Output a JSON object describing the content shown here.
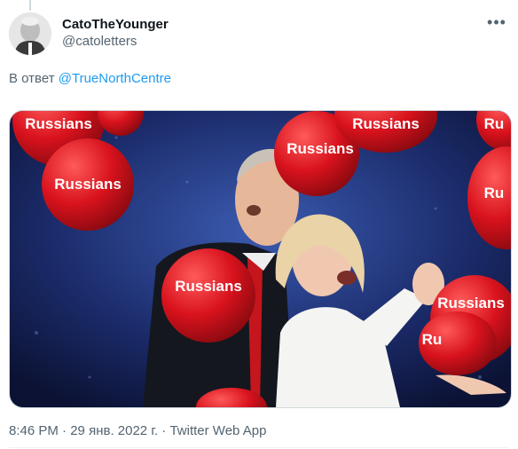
{
  "tweet": {
    "display_name": "CatoTheYounger",
    "handle": "@catoletters",
    "reply_prefix": "В ответ",
    "reply_to": "@TrueNorthCentre",
    "time": "8:46 PM",
    "separator1": "·",
    "date": "29 янв. 2022 г.",
    "separator2": "·",
    "source": "Twitter Web App",
    "more_icon": "more-horizontal-icon"
  },
  "image": {
    "balloons": [
      "Russians",
      "Russians",
      "Russians",
      "Russians",
      "Russians",
      "Ru",
      "Ru",
      "Russians",
      "Ru"
    ]
  },
  "colors": {
    "link": "#1d9bf0",
    "secondary_text": "#536471",
    "balloon": "#d8121d"
  }
}
